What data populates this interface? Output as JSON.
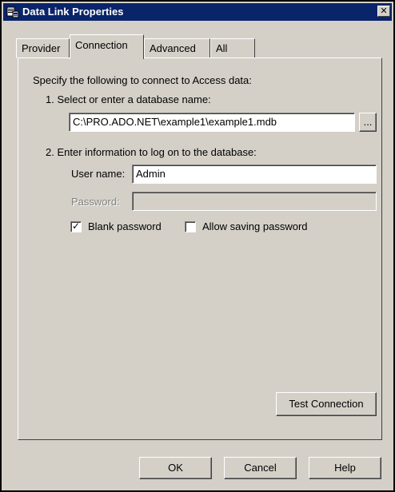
{
  "window": {
    "title": "Data Link Properties",
    "close_glyph": "✕"
  },
  "tabs": [
    {
      "label": "Provider",
      "active": false
    },
    {
      "label": "Connection",
      "active": true
    },
    {
      "label": "Advanced",
      "active": false
    },
    {
      "label": "All",
      "active": false
    }
  ],
  "connection": {
    "intro": "Specify the following to connect to Access data:",
    "step1_label": "1. Select or enter a database name:",
    "database_path": "C:\\PRO.ADO.NET\\example1\\example1.mdb",
    "browse_label": "...",
    "step2_label": "2. Enter information to log on to the database:",
    "username_label": "User name:",
    "username_value": "Admin",
    "password_label": "Password:",
    "password_value": "",
    "blank_password_label": "Blank password",
    "blank_password_checked": true,
    "allow_saving_label": "Allow saving password",
    "allow_saving_checked": false,
    "test_connection_label": "Test Connection"
  },
  "footer": {
    "ok_label": "OK",
    "cancel_label": "Cancel",
    "help_label": "Help"
  },
  "icons": {
    "title_icon": "data-link-icon",
    "check_glyph": "✓"
  }
}
